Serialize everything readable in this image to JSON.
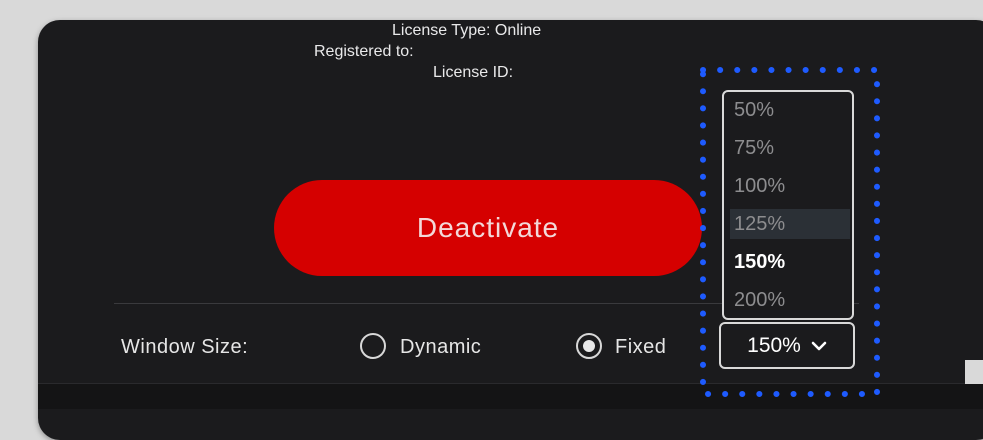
{
  "license": {
    "type_line": "License Type: Online",
    "registered_line": "Registered to:",
    "id_line": "License ID:"
  },
  "deactivate_label": "Deactivate",
  "window_size": {
    "label": "Window Size:",
    "options": [
      {
        "label": "Dynamic",
        "selected": false
      },
      {
        "label": "Fixed",
        "selected": true
      }
    ]
  },
  "zoom_dropdown": {
    "current": "150%",
    "options": [
      "50%",
      "75%",
      "100%",
      "125%",
      "150%",
      "200%"
    ],
    "hovered": "125%",
    "selected": "150%"
  },
  "colors": {
    "deactivate_button": "#d50000",
    "panel_background": "#1b1b1d",
    "focus_ring": "#1e5bff"
  },
  "icons": {
    "dropdown_chevron": "chevron-down-icon"
  }
}
